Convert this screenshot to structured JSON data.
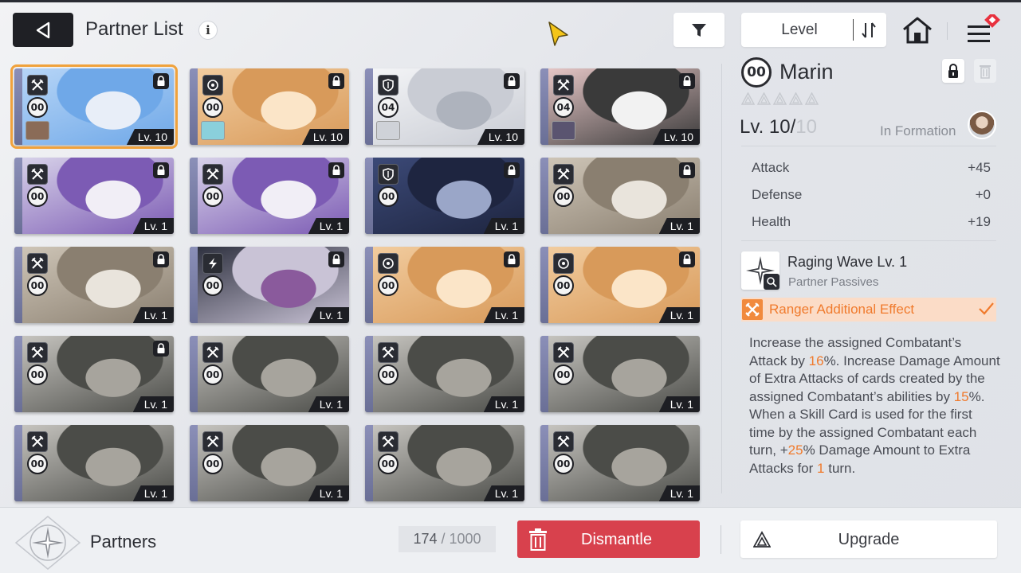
{
  "header": {
    "title": "Partner List",
    "info_glyph": "i",
    "sort_label": "Level"
  },
  "partners": [
    {
      "ego": "00",
      "level": "Lv. 10",
      "class_icon": "swords-icon",
      "locked": true,
      "art": [
        "#b8d6f7",
        "#6fa8e8",
        "#e8eef8"
      ],
      "mini": "#8a6b57",
      "selected": true
    },
    {
      "ego": "00",
      "level": "Lv. 10",
      "class_icon": "target-icon",
      "locked": true,
      "art": [
        "#f2cda0",
        "#d89a5a",
        "#fbe5c8"
      ],
      "mini": "#8ad0dc",
      "selected": false
    },
    {
      "ego": "04",
      "level": "Lv. 10",
      "class_icon": "shield-icon",
      "locked": true,
      "art": [
        "#f4f5f7",
        "#c9ccd4",
        "#aeb3bd"
      ],
      "mini": "#cfd2d8",
      "selected": false
    },
    {
      "ego": "04",
      "level": "Lv. 10",
      "class_icon": "swords-icon",
      "locked": true,
      "art": [
        "#e8c8c8",
        "#3a3a3a",
        "#f2f2f2"
      ],
      "mini": "#5a5470",
      "selected": false
    },
    {
      "ego": "00",
      "level": "Lv. 1",
      "class_icon": "swords-icon",
      "locked": true,
      "art": [
        "#d9d4ea",
        "#7c5bb4",
        "#f1eef6"
      ],
      "mini": null,
      "selected": false
    },
    {
      "ego": "00",
      "level": "Lv. 1",
      "class_icon": "swords-icon",
      "locked": true,
      "art": [
        "#d9d4ea",
        "#7c5bb4",
        "#f1eef6"
      ],
      "mini": null,
      "selected": false
    },
    {
      "ego": "00",
      "level": "Lv. 1",
      "class_icon": "shield-icon",
      "locked": true,
      "art": [
        "#3c4a78",
        "#1e2540",
        "#9aa6c8"
      ],
      "mini": null,
      "selected": false
    },
    {
      "ego": "00",
      "level": "Lv. 1",
      "class_icon": "swords-icon",
      "locked": true,
      "art": [
        "#cfc6b8",
        "#8a7f70",
        "#e9e4dc"
      ],
      "mini": null,
      "selected": false
    },
    {
      "ego": "00",
      "level": "Lv. 1",
      "class_icon": "swords-icon",
      "locked": true,
      "art": [
        "#cfc6b8",
        "#8a7f70",
        "#e9e4dc"
      ],
      "mini": null,
      "selected": false
    },
    {
      "ego": "00",
      "level": "Lv. 1",
      "class_icon": "bolt-icon",
      "locked": true,
      "art": [
        "#2b2e3c",
        "#c9c3d6",
        "#8a5a9c"
      ],
      "mini": null,
      "selected": false
    },
    {
      "ego": "00",
      "level": "Lv. 1",
      "class_icon": "target-icon",
      "locked": true,
      "art": [
        "#f2cda0",
        "#d89a5a",
        "#fbe5c8"
      ],
      "mini": null,
      "selected": false
    },
    {
      "ego": "00",
      "level": "Lv. 1",
      "class_icon": "target-icon",
      "locked": true,
      "art": [
        "#f2cda0",
        "#d89a5a",
        "#fbe5c8"
      ],
      "mini": null,
      "selected": false
    },
    {
      "ego": "00",
      "level": "Lv. 1",
      "class_icon": "swords-icon",
      "locked": true,
      "art": [
        "#c8c6c1",
        "#4b4c48",
        "#a7a49d"
      ],
      "mini": null,
      "selected": false
    },
    {
      "ego": "00",
      "level": "Lv. 1",
      "class_icon": "swords-icon",
      "locked": false,
      "art": [
        "#c8c6c1",
        "#4b4c48",
        "#a7a49d"
      ],
      "mini": null,
      "selected": false
    },
    {
      "ego": "00",
      "level": "Lv. 1",
      "class_icon": "swords-icon",
      "locked": false,
      "art": [
        "#c8c6c1",
        "#4b4c48",
        "#a7a49d"
      ],
      "mini": null,
      "selected": false
    },
    {
      "ego": "00",
      "level": "Lv. 1",
      "class_icon": "swords-icon",
      "locked": false,
      "art": [
        "#c8c6c1",
        "#4b4c48",
        "#a7a49d"
      ],
      "mini": null,
      "selected": false
    },
    {
      "ego": "00",
      "level": "Lv. 1",
      "class_icon": "swords-icon",
      "locked": false,
      "art": [
        "#c8c6c1",
        "#4b4c48",
        "#a7a49d"
      ],
      "mini": null,
      "selected": false
    },
    {
      "ego": "00",
      "level": "Lv. 1",
      "class_icon": "swords-icon",
      "locked": false,
      "art": [
        "#c8c6c1",
        "#4b4c48",
        "#a7a49d"
      ],
      "mini": null,
      "selected": false
    },
    {
      "ego": "00",
      "level": "Lv. 1",
      "class_icon": "swords-icon",
      "locked": false,
      "art": [
        "#c8c6c1",
        "#4b4c48",
        "#a7a49d"
      ],
      "mini": null,
      "selected": false
    },
    {
      "ego": "00",
      "level": "Lv. 1",
      "class_icon": "swords-icon",
      "locked": false,
      "art": [
        "#c8c6c1",
        "#4b4c48",
        "#a7a49d"
      ],
      "mini": null,
      "selected": false
    }
  ],
  "detail": {
    "ego": "00",
    "name": "Marin",
    "stars": 5,
    "level_prefix": "Lv. 10/",
    "level_max": "10",
    "formation_label": "In Formation",
    "stats": [
      {
        "label": "Attack",
        "value": "+45"
      },
      {
        "label": "Defense",
        "value": "+0"
      },
      {
        "label": "Health",
        "value": "+19"
      }
    ],
    "skill": {
      "name": "Raging Wave Lv. 1",
      "subtitle": "Partner Passives"
    },
    "ranger_label": "Ranger Additional Effect",
    "desc": [
      {
        "t": "Increase the assigned Combatant’s Attack by "
      },
      {
        "t": "16",
        "hl": true
      },
      {
        "t": "%. Increase Damage Amount of Extra Attacks of cards created by the assigned Combatant’s abilities by "
      },
      {
        "t": "15",
        "hl": true
      },
      {
        "t": "%. When a Skill Card is used for the first time by the assigned Combatant each turn, +"
      },
      {
        "t": "25",
        "hl": true
      },
      {
        "t": "% Damage Amount to Extra Attacks for "
      },
      {
        "t": "1",
        "hl": true
      },
      {
        "t": " turn."
      }
    ]
  },
  "bottom": {
    "title": "Partners",
    "count": "174",
    "count_sep": " / ",
    "count_max": "1000",
    "dismantle_label": "Dismantle",
    "upgrade_label": "Upgrade"
  },
  "colors": {
    "accent_orange": "#f07a2c",
    "dismantle_red": "#d8414d",
    "selected_outline": "#f0a23c",
    "dark": "#1f2025"
  }
}
